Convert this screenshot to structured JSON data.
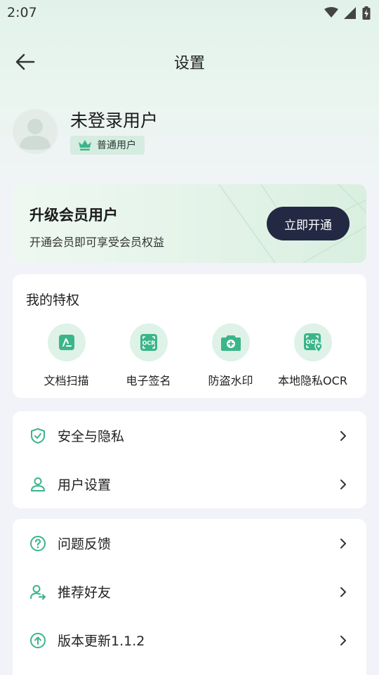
{
  "status_bar": {
    "time": "2:07"
  },
  "nav": {
    "title": "设置"
  },
  "profile": {
    "name": "未登录用户",
    "badge": "普通用户"
  },
  "vip_card": {
    "title": "升级会员用户",
    "subtitle": "开通会员即可享受会员权益",
    "button": "立即开通"
  },
  "privileges": {
    "title": "我的特权",
    "items": [
      {
        "label": "文档扫描",
        "icon": "document-scan-icon"
      },
      {
        "label": "电子签名",
        "icon": "ocr-signature-icon"
      },
      {
        "label": "防盗水印",
        "icon": "camera-watermark-icon"
      },
      {
        "label": "本地隐私OCR",
        "icon": "local-ocr-icon"
      }
    ]
  },
  "menu_group_1": [
    {
      "label": "安全与隐私",
      "icon": "shield-icon"
    },
    {
      "label": "用户设置",
      "icon": "user-icon"
    }
  ],
  "menu_group_2": [
    {
      "label": "问题反馈",
      "icon": "question-icon"
    },
    {
      "label": "推荐好友",
      "icon": "recommend-user-icon"
    },
    {
      "label": "版本更新1.1.2",
      "icon": "update-icon"
    }
  ],
  "colors": {
    "accent": "#3bb58a",
    "button_dark": "#232942",
    "icon_bg": "#def2e8"
  }
}
